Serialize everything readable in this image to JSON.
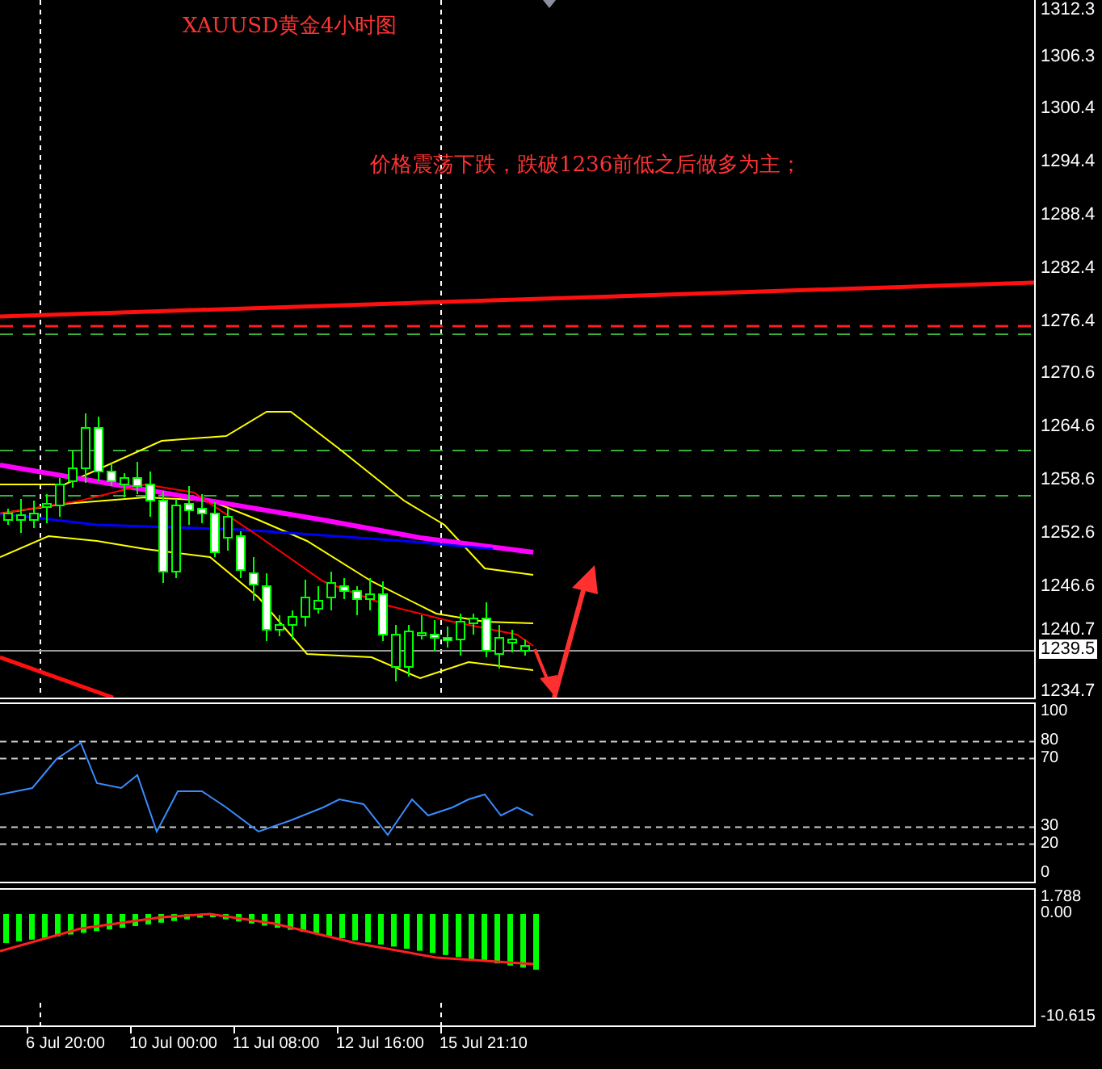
{
  "chart": {
    "title": "XAUUSD黄金4小时图",
    "annotation": "价格震荡下跌，跌破1236前低之后做多为主；",
    "price_axis": [
      {
        "label": "1312.3",
        "kind": "tick"
      },
      {
        "label": "1306.3",
        "kind": "tick"
      },
      {
        "label": "1300.4",
        "kind": "tick"
      },
      {
        "label": "1294.4",
        "kind": "tick"
      },
      {
        "label": "1288.4",
        "kind": "tick"
      },
      {
        "label": "1282.4",
        "kind": "tick"
      },
      {
        "label": "1276.4",
        "kind": "tick"
      },
      {
        "label": "1270.6",
        "kind": "tick"
      },
      {
        "label": "1264.6",
        "kind": "tick"
      },
      {
        "label": "1258.6",
        "kind": "tick"
      },
      {
        "label": "1252.6",
        "kind": "tick"
      },
      {
        "label": "1246.6",
        "kind": "tick"
      },
      {
        "label": "1240.7",
        "kind": "tick"
      },
      {
        "label": "1239.5",
        "kind": "current"
      },
      {
        "label": "1234.7",
        "kind": "tick"
      }
    ],
    "rsi_axis": [
      "100",
      "80",
      "70",
      "30",
      "20",
      "0"
    ],
    "macd_axis": [
      "1.788",
      "0.00",
      "-10.615"
    ],
    "time_axis": [
      "6 Jul 20:00",
      "10 Jul 00:00",
      "11 Jul 08:00",
      "12 Jul 16:00",
      "15 Jul 21:10"
    ]
  }
}
